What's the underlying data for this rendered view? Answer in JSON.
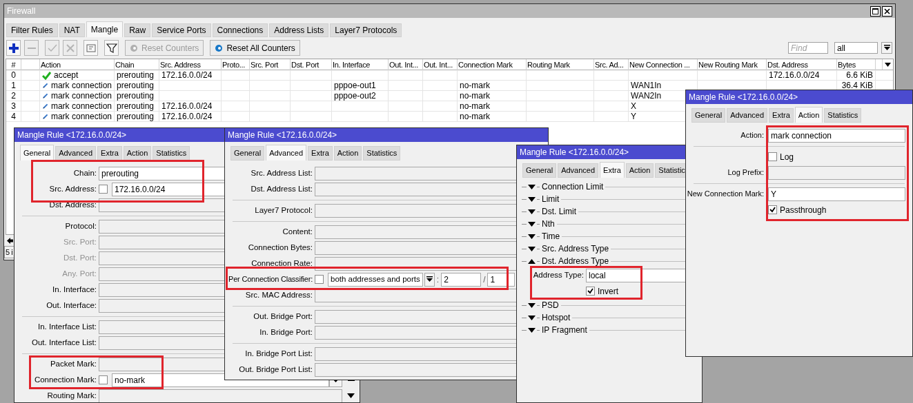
{
  "firewall": {
    "title": "Firewall",
    "tabs": [
      {
        "label": "Filter Rules",
        "selected": false
      },
      {
        "label": "NAT",
        "selected": false
      },
      {
        "label": "Mangle",
        "selected": true
      },
      {
        "label": "Raw",
        "selected": false
      },
      {
        "label": "Service Ports",
        "selected": false
      },
      {
        "label": "Connections",
        "selected": false
      },
      {
        "label": "Address Lists",
        "selected": false
      },
      {
        "label": "Layer7 Protocols",
        "selected": false
      }
    ],
    "toolbar": [
      {
        "kind": "add",
        "disabled": false
      },
      {
        "kind": "remove",
        "disabled": true
      },
      {
        "kind": "enable",
        "disabled": true
      },
      {
        "kind": "disable",
        "disabled": true
      },
      {
        "kind": "comment",
        "disabled": false
      },
      {
        "kind": "filter",
        "disabled": false
      },
      {
        "kind": "reset",
        "label": "Reset Counters",
        "disabled": true
      },
      {
        "kind": "reset",
        "label": "Reset All Counters",
        "disabled": false
      }
    ],
    "find": {
      "placeholder": "Find"
    },
    "filter": {
      "value": "all"
    },
    "table": {
      "columns": [
        {
          "label": "#"
        },
        {},
        {
          "label": "Action"
        },
        {
          "label": "Chain"
        },
        {
          "label": "Src. Address"
        },
        {
          "label": "Proto..."
        },
        {
          "label": "Src. Port"
        },
        {
          "label": "Dst. Port"
        },
        {
          "label": "In. Interface"
        },
        {
          "label": "Out. Int..."
        },
        {
          "label": "Out. Int..."
        },
        {
          "label": "Connection Mark"
        },
        {
          "label": "Routing Mark"
        },
        {
          "label": "Src. Ad..."
        },
        {
          "label": "New Connection ..."
        },
        {
          "label": "New Routing Mark"
        },
        {
          "label": "Dst. Address"
        },
        {
          "label": "Bytes"
        }
      ],
      "rows": [
        {
          "kind": "accept",
          "number": "0",
          "action": "accept",
          "chain": "prerouting",
          "src_address": "172.16.0.0/24",
          "dst_address": "172.16.0.0/24",
          "bytes": "6.6 KiB"
        },
        {
          "kind": "mark",
          "number": "1",
          "action": "mark connection",
          "chain": "prerouting",
          "in_interface": "pppoe-out1",
          "connection_mark": "no-mark",
          "new_connection_mark": "WAN1In",
          "bytes": "36.4 KiB"
        },
        {
          "kind": "mark",
          "number": "2",
          "action": "mark connection",
          "chain": "prerouting",
          "in_interface": "pppoe-out2",
          "connection_mark": "no-mark",
          "new_connection_mark": "WAN2In"
        },
        {
          "kind": "mark",
          "number": "3",
          "action": "mark connection",
          "chain": "prerouting",
          "src_address": "172.16.0.0/24",
          "connection_mark": "no-mark",
          "new_connection_mark": "X"
        },
        {
          "kind": "mark",
          "number": "4",
          "action": "mark connection",
          "chain": "prerouting",
          "src_address": "172.16.0.0/24",
          "connection_mark": "no-mark",
          "new_connection_mark": "Y"
        }
      ]
    },
    "status": "5 i"
  },
  "dialogs": [
    {
      "title": "Mangle Rule <172.16.0.0/24>",
      "tabs": [
        {
          "label": "General",
          "selected": true
        },
        {
          "label": "Advanced",
          "selected": false
        },
        {
          "label": "Extra",
          "selected": false
        },
        {
          "label": "Action",
          "selected": false
        },
        {
          "label": "Statistics",
          "selected": false
        }
      ],
      "items": [
        {
          "kind": "field",
          "label": "Chain:",
          "value": "prerouting",
          "disabled": false
        },
        {
          "kind": "field",
          "label": "Src. Address:",
          "negated": false,
          "value": "172.16.0.0/24",
          "disabled": false
        },
        {
          "kind": "field",
          "label": "Dst. Address:",
          "disabled": false
        },
        {
          "kind": "separator"
        },
        {
          "kind": "field",
          "label": "Protocol:",
          "disabled": false
        },
        {
          "kind": "field",
          "label": "Src. Port:",
          "disabled": true
        },
        {
          "kind": "field",
          "label": "Dst. Port:",
          "disabled": true
        },
        {
          "kind": "field",
          "label": "Any. Port:",
          "disabled": true
        },
        {
          "kind": "field",
          "label": "In. Interface:",
          "disabled": false
        },
        {
          "kind": "field",
          "label": "Out. Interface:",
          "disabled": false
        },
        {
          "kind": "separator"
        },
        {
          "kind": "field",
          "label": "In. Interface List:",
          "disabled": false
        },
        {
          "kind": "field",
          "label": "Out. Interface List:",
          "disabled": false
        },
        {
          "kind": "separator"
        },
        {
          "kind": "field",
          "label": "Packet Mark:",
          "disabled": false
        },
        {
          "kind": "combo",
          "label": "Connection Mark:",
          "negated": false,
          "value": "no-mark",
          "disabled": false
        },
        {
          "kind": "expandable",
          "label": "Routing Mark:",
          "disabled": false
        }
      ]
    },
    {
      "title": "Mangle Rule <172.16.0.0/24>",
      "tabs": [
        {
          "label": "General",
          "selected": false
        },
        {
          "label": "Advanced",
          "selected": true
        },
        {
          "label": "Extra",
          "selected": false
        },
        {
          "label": "Action",
          "selected": false
        },
        {
          "label": "Statistics",
          "selected": false
        }
      ],
      "items": [
        {
          "kind": "field",
          "label": "Src. Address List:",
          "disabled": false
        },
        {
          "kind": "field",
          "label": "Dst. Address List:",
          "disabled": false
        },
        {
          "kind": "separator"
        },
        {
          "kind": "field",
          "label": "Layer7 Protocol:",
          "disabled": false
        },
        {
          "kind": "separator"
        },
        {
          "kind": "field",
          "label": "Content:",
          "disabled": false
        },
        {
          "kind": "field",
          "label": "Connection Bytes:",
          "disabled": false
        },
        {
          "kind": "field",
          "label": "Connection Rate:",
          "disabled": false
        },
        {
          "kind": "pcc",
          "label": "Per Connection Classifier:",
          "negated": false,
          "classifier": "both addresses and ports",
          "separator_1": ":",
          "modulus": "2",
          "separator_2": "/",
          "remainder": "1"
        },
        {
          "kind": "field",
          "label": "Src. MAC Address:",
          "disabled": false
        },
        {
          "kind": "separator"
        },
        {
          "kind": "field",
          "label": "Out. Bridge Port:",
          "disabled": false
        },
        {
          "kind": "field",
          "label": "In. Bridge Port:",
          "disabled": false
        },
        {
          "kind": "separator"
        },
        {
          "kind": "field",
          "label": "In. Bridge Port List:",
          "disabled": false
        },
        {
          "kind": "field",
          "label": "Out. Bridge Port List:",
          "disabled": false
        }
      ]
    },
    {
      "title": "Mangle Rule <172.16.0.0/24>",
      "tabs": [
        {
          "label": "General",
          "selected": false
        },
        {
          "label": "Advanced",
          "selected": false
        },
        {
          "label": "Extra",
          "selected": true
        },
        {
          "label": "Action",
          "selected": false
        },
        {
          "label": "Statistic",
          "selected": false
        }
      ],
      "items": [
        {
          "kind": "section",
          "label": "Connection Limit",
          "expanded": false
        },
        {
          "kind": "section",
          "label": "Limit",
          "expanded": false
        },
        {
          "kind": "section",
          "label": "Dst. Limit",
          "expanded": false
        },
        {
          "kind": "section",
          "label": "Nth",
          "expanded": false
        },
        {
          "kind": "section",
          "label": "Time",
          "expanded": false
        },
        {
          "kind": "section",
          "label": "Src. Address Type",
          "expanded": false
        },
        {
          "kind": "section",
          "label": "Dst. Address Type",
          "expanded": true,
          "children": [
            {
              "kind": "field",
              "label": "Address Type:",
              "value": "local",
              "disabled": false
            },
            {
              "kind": "checkbox",
              "label": "Invert",
              "checked": true
            }
          ]
        },
        {
          "kind": "section",
          "label": "PSD",
          "expanded": false
        },
        {
          "kind": "section",
          "label": "Hotspot",
          "expanded": false
        },
        {
          "kind": "section",
          "label": "IP Fragment",
          "expanded": false
        }
      ]
    },
    {
      "title": "Mangle Rule <172.16.0.0/24>",
      "tabs": [
        {
          "label": "General",
          "selected": false
        },
        {
          "label": "Advanced",
          "selected": false
        },
        {
          "label": "Extra",
          "selected": false
        },
        {
          "label": "Action",
          "selected": true
        },
        {
          "label": "Statistics",
          "selected": false
        }
      ],
      "items": [
        {
          "kind": "field",
          "label": "Action:",
          "value": "mark connection",
          "disabled": false
        },
        {
          "kind": "separator"
        },
        {
          "kind": "checkbox",
          "label": "Log",
          "checked": false
        },
        {
          "kind": "field",
          "label": "Log Prefix:",
          "disabled": false
        },
        {
          "kind": "separator"
        },
        {
          "kind": "field",
          "label": "New Connection Mark:",
          "value": "Y",
          "disabled": false
        },
        {
          "kind": "checkbox",
          "label": "Passthrough",
          "checked": true
        }
      ]
    }
  ]
}
